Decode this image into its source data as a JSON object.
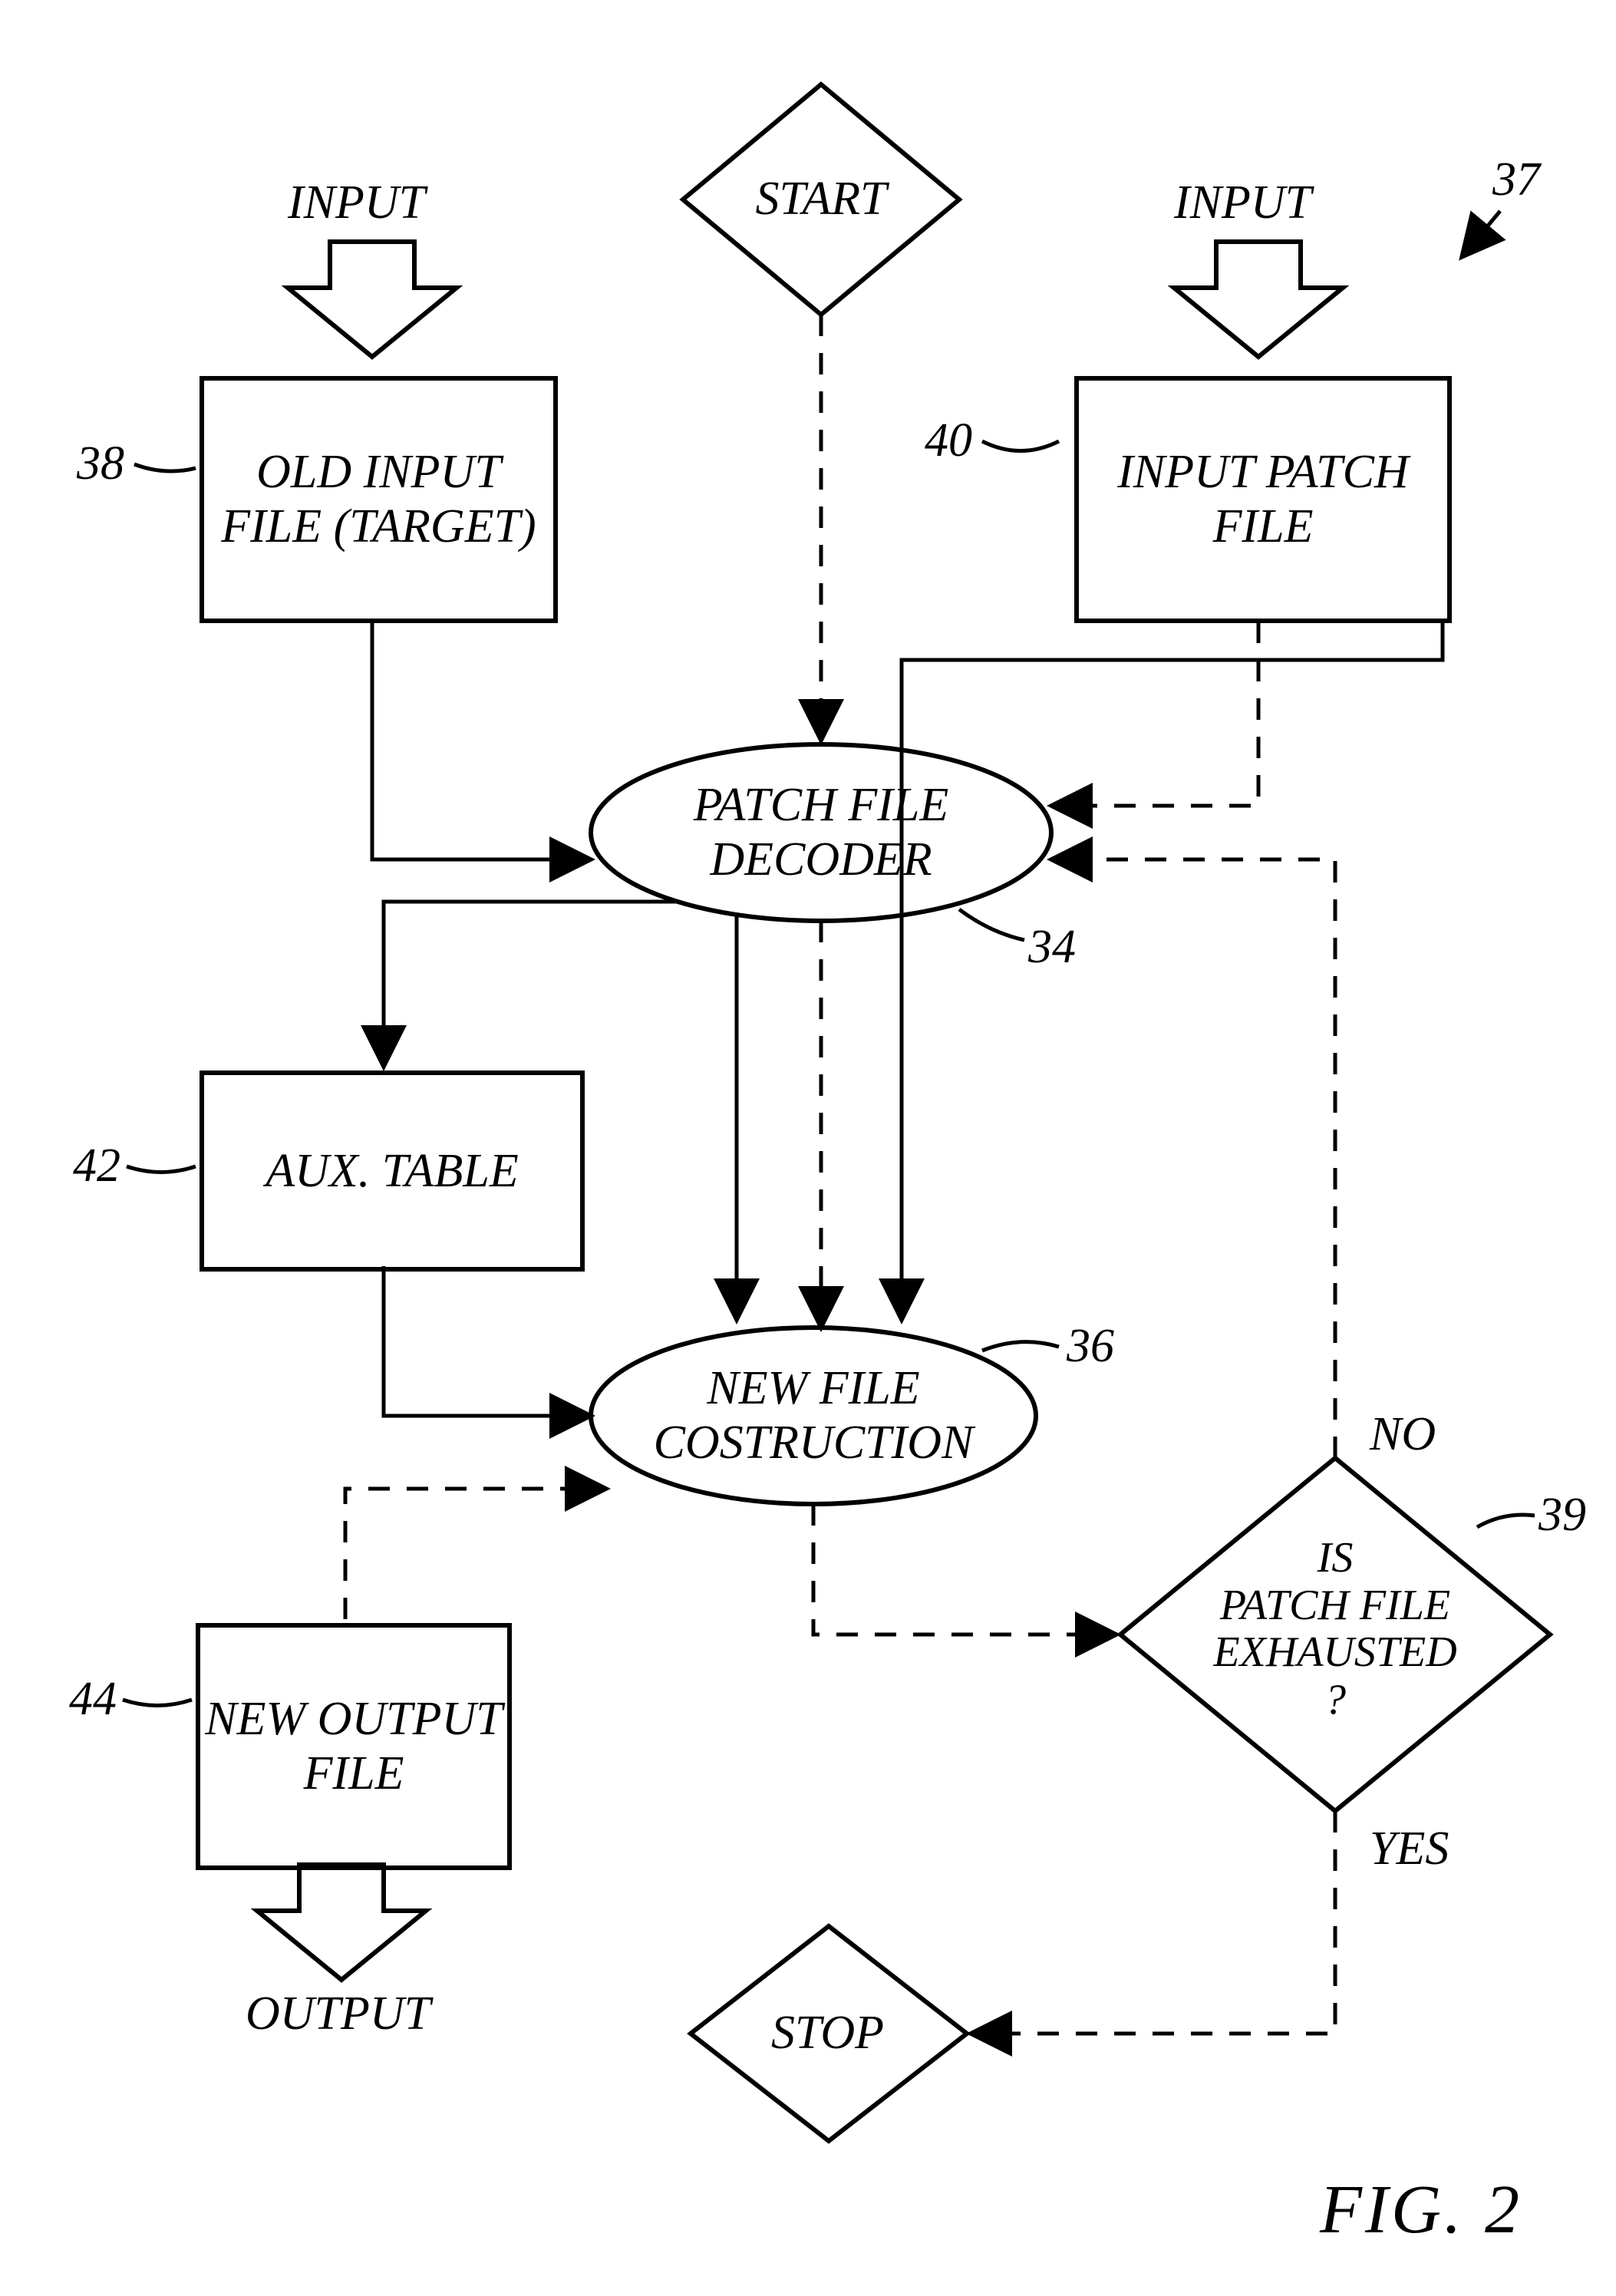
{
  "figure_label": "FIG. 2",
  "pointer_37": "37",
  "input_left": {
    "caption": "INPUT",
    "ref": "38",
    "text": "OLD\nINPUT FILE\n(TARGET)"
  },
  "input_right": {
    "caption": "INPUT",
    "ref": "40",
    "text": "INPUT\nPATCH FILE"
  },
  "start": "START",
  "decoder": {
    "ref": "34",
    "text": "PATCH FILE\nDECODER"
  },
  "aux_table": {
    "ref": "42",
    "text": "AUX. TABLE"
  },
  "construction": {
    "ref": "36",
    "text": "NEW FILE\nCOSTRUCTION"
  },
  "decision": {
    "ref": "39",
    "text": "IS\nPATCH FILE\nEXHAUSTED\n?",
    "no": "NO",
    "yes": "YES"
  },
  "output_file": {
    "ref": "44",
    "text": "NEW\nOUTPUT FILE",
    "caption": "OUTPUT"
  },
  "stop": "STOP"
}
